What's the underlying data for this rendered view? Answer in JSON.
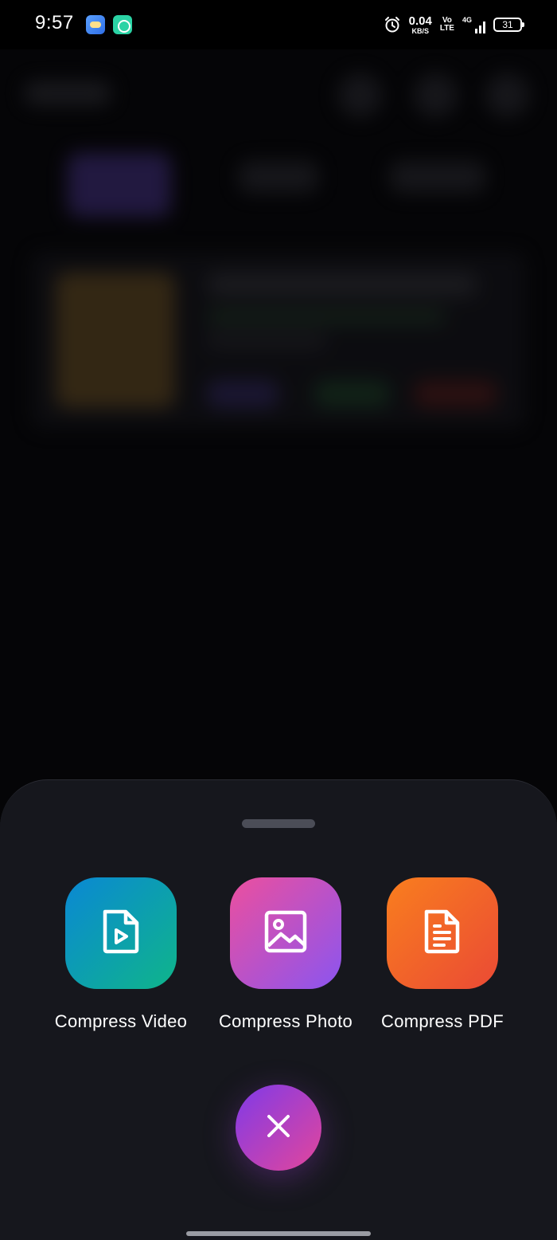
{
  "status_bar": {
    "time": "9:57",
    "net_speed_value": "0.04",
    "net_speed_unit": "KB/S",
    "volte_top": "Vo",
    "volte_bottom": "LTE",
    "network_type": "4G",
    "battery_level": "31"
  },
  "sheet": {
    "actions": [
      {
        "label": "Compress Video",
        "icon": "video-file-icon",
        "color_from": "#0a88d4",
        "color_to": "#0fb58a"
      },
      {
        "label": "Compress Photo",
        "icon": "image-icon",
        "color_from": "#ec4f9e",
        "color_to": "#8b55ef"
      },
      {
        "label": "Compress PDF",
        "icon": "document-icon",
        "color_from": "#f97e1e",
        "color_to": "#ea4a35"
      }
    ],
    "close_icon": "close-icon"
  }
}
